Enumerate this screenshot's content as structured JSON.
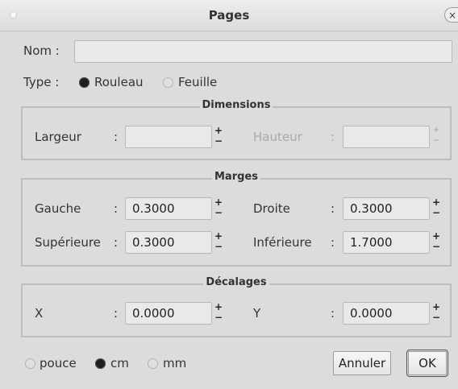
{
  "window": {
    "title": "Pages",
    "close_glyph": "×"
  },
  "nom": {
    "label": "Nom",
    "value": ""
  },
  "type": {
    "label": "Type",
    "options": [
      "Rouleau",
      "Feuille"
    ],
    "selected": "Rouleau"
  },
  "dimensions": {
    "title": "Dimensions",
    "width_label": "Largeur",
    "width_value": "",
    "height_label": "Hauteur",
    "height_value": ""
  },
  "margins": {
    "title": "Marges",
    "left_label": "Gauche",
    "left_value": "0.3000",
    "right_label": "Droite",
    "right_value": "0.3000",
    "top_label": "Supérieure",
    "top_value": "0.3000",
    "bottom_label": "Inférieure",
    "bottom_value": "1.7000"
  },
  "offsets": {
    "title": "Décalages",
    "x_label": "X",
    "x_value": "0.0000",
    "y_label": "Y",
    "y_value": "0.0000"
  },
  "units": {
    "options": [
      "pouce",
      "cm",
      "mm"
    ],
    "selected": "cm"
  },
  "common": {
    "colon": ":",
    "plus": "+",
    "minus": "−"
  },
  "buttons": {
    "cancel": "Annuler",
    "ok": "OK"
  },
  "colors": {
    "window_bg": "#dcdcdc",
    "input_bg": "#e9e9e9",
    "frame_border": "#bdbdbd"
  }
}
